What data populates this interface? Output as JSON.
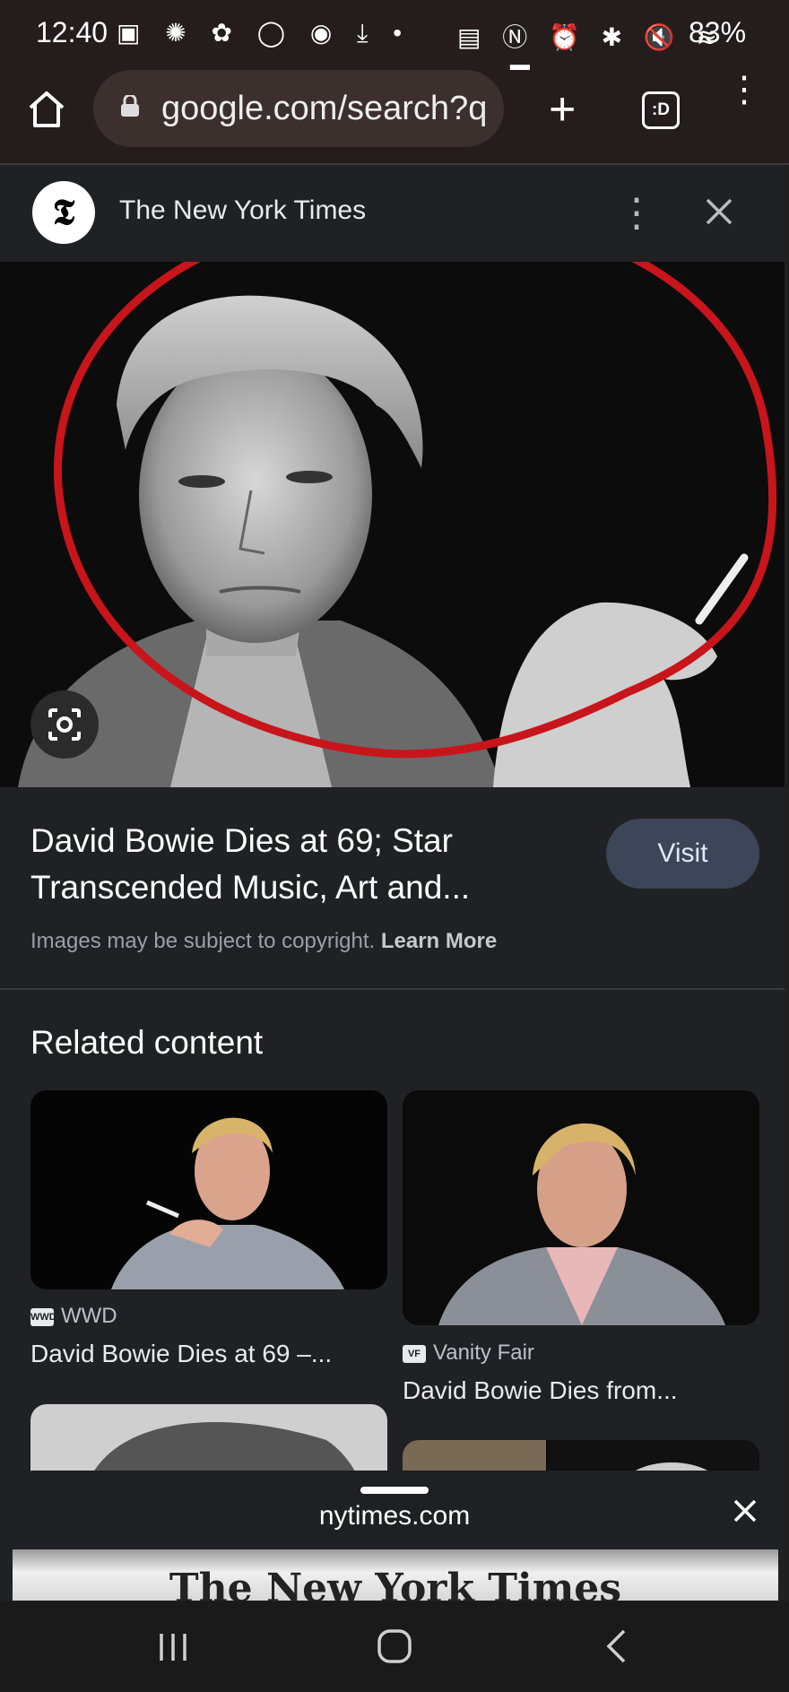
{
  "status_bar": {
    "time": "12:40",
    "battery": "83%",
    "left_icons": [
      "notification-icon",
      "settings-icon",
      "flower-icon",
      "chat-icon",
      "sync-icon",
      "download-icon",
      "dot-icon"
    ],
    "right_icons": [
      "battery-saver-icon",
      "nfc-icon",
      "alarm-icon",
      "bluetooth-icon",
      "mute-icon",
      "wifi-icon",
      "signal-icon"
    ]
  },
  "browser": {
    "url": "google.com/search?q",
    "tabs_count": ":D"
  },
  "viewer": {
    "source": "The New York Times",
    "source_logo": "𝕿",
    "title": "David Bowie Dies at 69; Star Transcended Music, Art and...",
    "visit_label": "Visit",
    "copyright_text": "Images may be subject to copyright.",
    "learn_more": "Learn More"
  },
  "related": {
    "heading": "Related content",
    "items": [
      {
        "source": "WWD",
        "source_icon": "WWD",
        "title": "David Bowie Dies at 69 –..."
      },
      {
        "source": "Vanity Fair",
        "source_icon": "VF",
        "title": "David Bowie Dies from..."
      }
    ]
  },
  "sheet": {
    "title": "nytimes.com",
    "banner_text": "The New York Times"
  },
  "colors": {
    "annotation_circle": "#c8151b",
    "visit_button": "#3c4658",
    "background": "#202124"
  }
}
